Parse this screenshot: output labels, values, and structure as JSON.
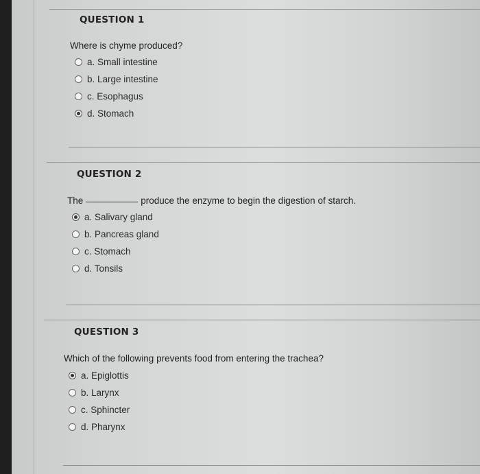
{
  "questions": [
    {
      "title": "QUESTION 1",
      "text": "Where is chyme produced?",
      "options": [
        {
          "label": "a. Small intestine",
          "selected": false
        },
        {
          "label": "b. Large intestine",
          "selected": false
        },
        {
          "label": "c. Esophagus",
          "selected": false
        },
        {
          "label": "d. Stomach",
          "selected": true
        }
      ]
    },
    {
      "title": "QUESTION 2",
      "text_before": "The",
      "text_after": "produce the enzyme to begin the digestion of starch.",
      "options": [
        {
          "label": "a. Salivary gland",
          "selected": true
        },
        {
          "label": "b. Pancreas gland",
          "selected": false
        },
        {
          "label": "c. Stomach",
          "selected": false
        },
        {
          "label": "d. Tonsils",
          "selected": false
        }
      ]
    },
    {
      "title": "QUESTION 3",
      "text": "Which of the following prevents food from entering the trachea?",
      "options": [
        {
          "label": "a. Epiglottis",
          "selected": true
        },
        {
          "label": "b. Larynx",
          "selected": false
        },
        {
          "label": "c. Sphincter",
          "selected": false
        },
        {
          "label": "d. Pharynx",
          "selected": false
        }
      ]
    }
  ]
}
